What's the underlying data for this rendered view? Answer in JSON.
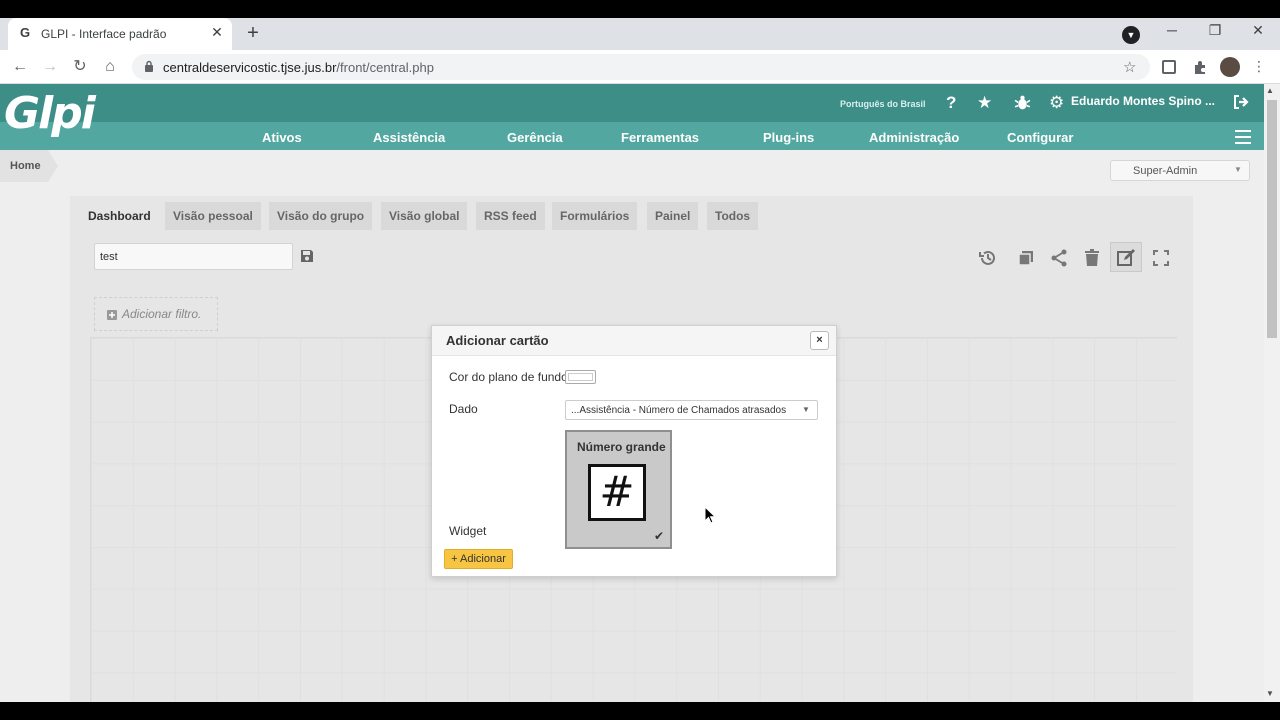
{
  "browser": {
    "tab_title": "GLPI - Interface padrão",
    "favicon": "G",
    "url_host": "centraldeservicostic.tjse.jus.br",
    "url_path": "/front/central.php"
  },
  "header": {
    "logo": "Glpi",
    "language": "Português do Brasil",
    "user_name": "Eduardo Montes Spino ...",
    "menu": [
      "Ativos",
      "Assistência",
      "Gerência",
      "Ferramentas",
      "Plug-ins",
      "Administração",
      "Configurar"
    ]
  },
  "breadcrumb": {
    "home": "Home"
  },
  "profile": {
    "selected": "Super-Admin"
  },
  "dashboard": {
    "tabs": [
      "Dashboard",
      "Visão pessoal",
      "Visão do grupo",
      "Visão global",
      "RSS feed",
      "Formulários",
      "Painel",
      "Todos"
    ],
    "name_value": "test",
    "add_filter_label": "Adicionar filtro."
  },
  "modal": {
    "title": "Adicionar cartão",
    "close_glyph": "×",
    "bg_color_label": "Cor do plano de fundo",
    "bg_color_value": "#ffffff",
    "data_label": "Dado",
    "data_value": "...Assistência - Número de Chamados atrasados",
    "widget_label": "Widget",
    "widget_name": "Número grande",
    "widget_symbol": "#",
    "add_button": "+ Adicionar"
  },
  "colors": {
    "header_dark": "#3e8e88",
    "header_light": "#52a7a0",
    "add_button": "#f7c542"
  }
}
